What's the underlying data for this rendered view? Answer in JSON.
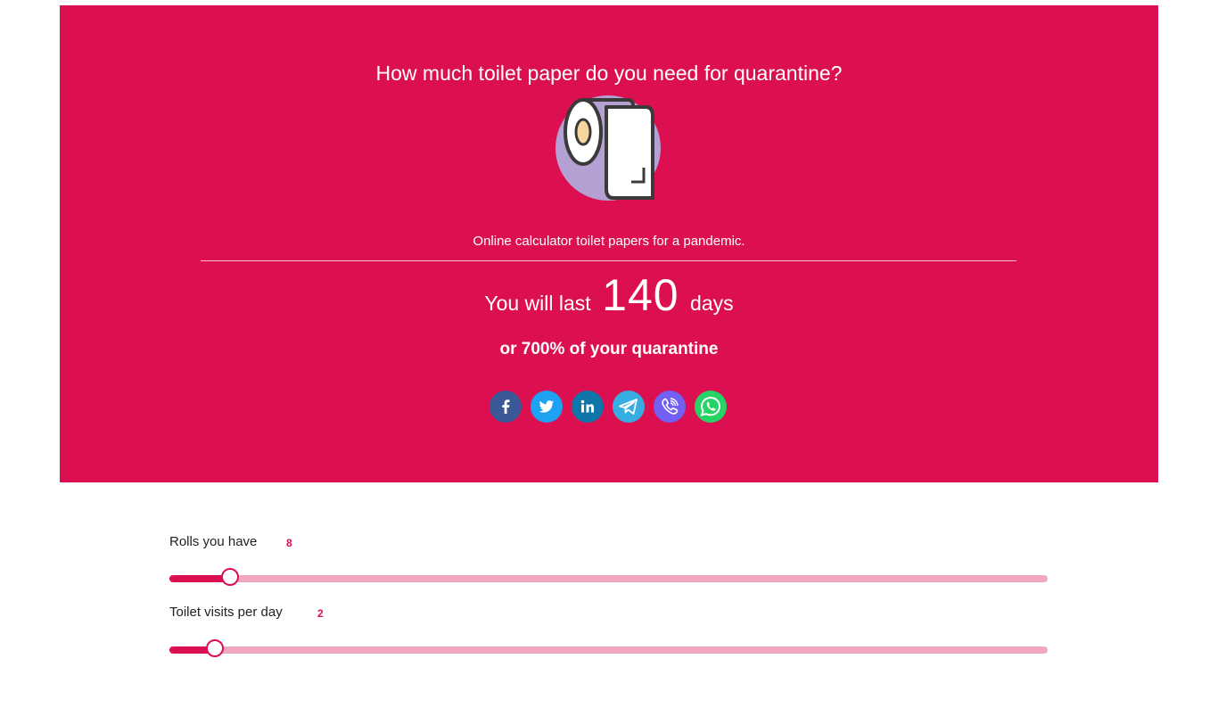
{
  "hero": {
    "title": "How much toilet paper do you need for quarantine?",
    "icon": "toilet-paper-icon",
    "subtitle": "Online calculator toilet papers for a pandemic.",
    "background_color": "#dc0f50"
  },
  "result": {
    "prefix": "You will last",
    "days": "140",
    "suffix": "days",
    "percent_line": "or 700% of your quarantine"
  },
  "share": [
    {
      "name": "facebook",
      "icon": "facebook-icon",
      "color": "#3b5998"
    },
    {
      "name": "twitter",
      "icon": "twitter-icon",
      "color": "#1da1f2"
    },
    {
      "name": "linkedin",
      "icon": "linkedin-icon",
      "color": "#0e76a8"
    },
    {
      "name": "telegram",
      "icon": "telegram-icon",
      "color": "#37aee2"
    },
    {
      "name": "viber",
      "icon": "viber-icon",
      "color": "#7360f2"
    },
    {
      "name": "whatsapp",
      "icon": "whatsapp-icon",
      "color": "#25d366"
    }
  ],
  "sliders": {
    "rolls": {
      "label": "Rolls you have",
      "value": "8",
      "fill_fraction": 0.07
    },
    "visits": {
      "label": "Toilet visits per day",
      "value": "2",
      "fill_fraction": 0.053
    }
  },
  "colors": {
    "accent": "#dc0f50",
    "track": "#f1a7bf"
  }
}
